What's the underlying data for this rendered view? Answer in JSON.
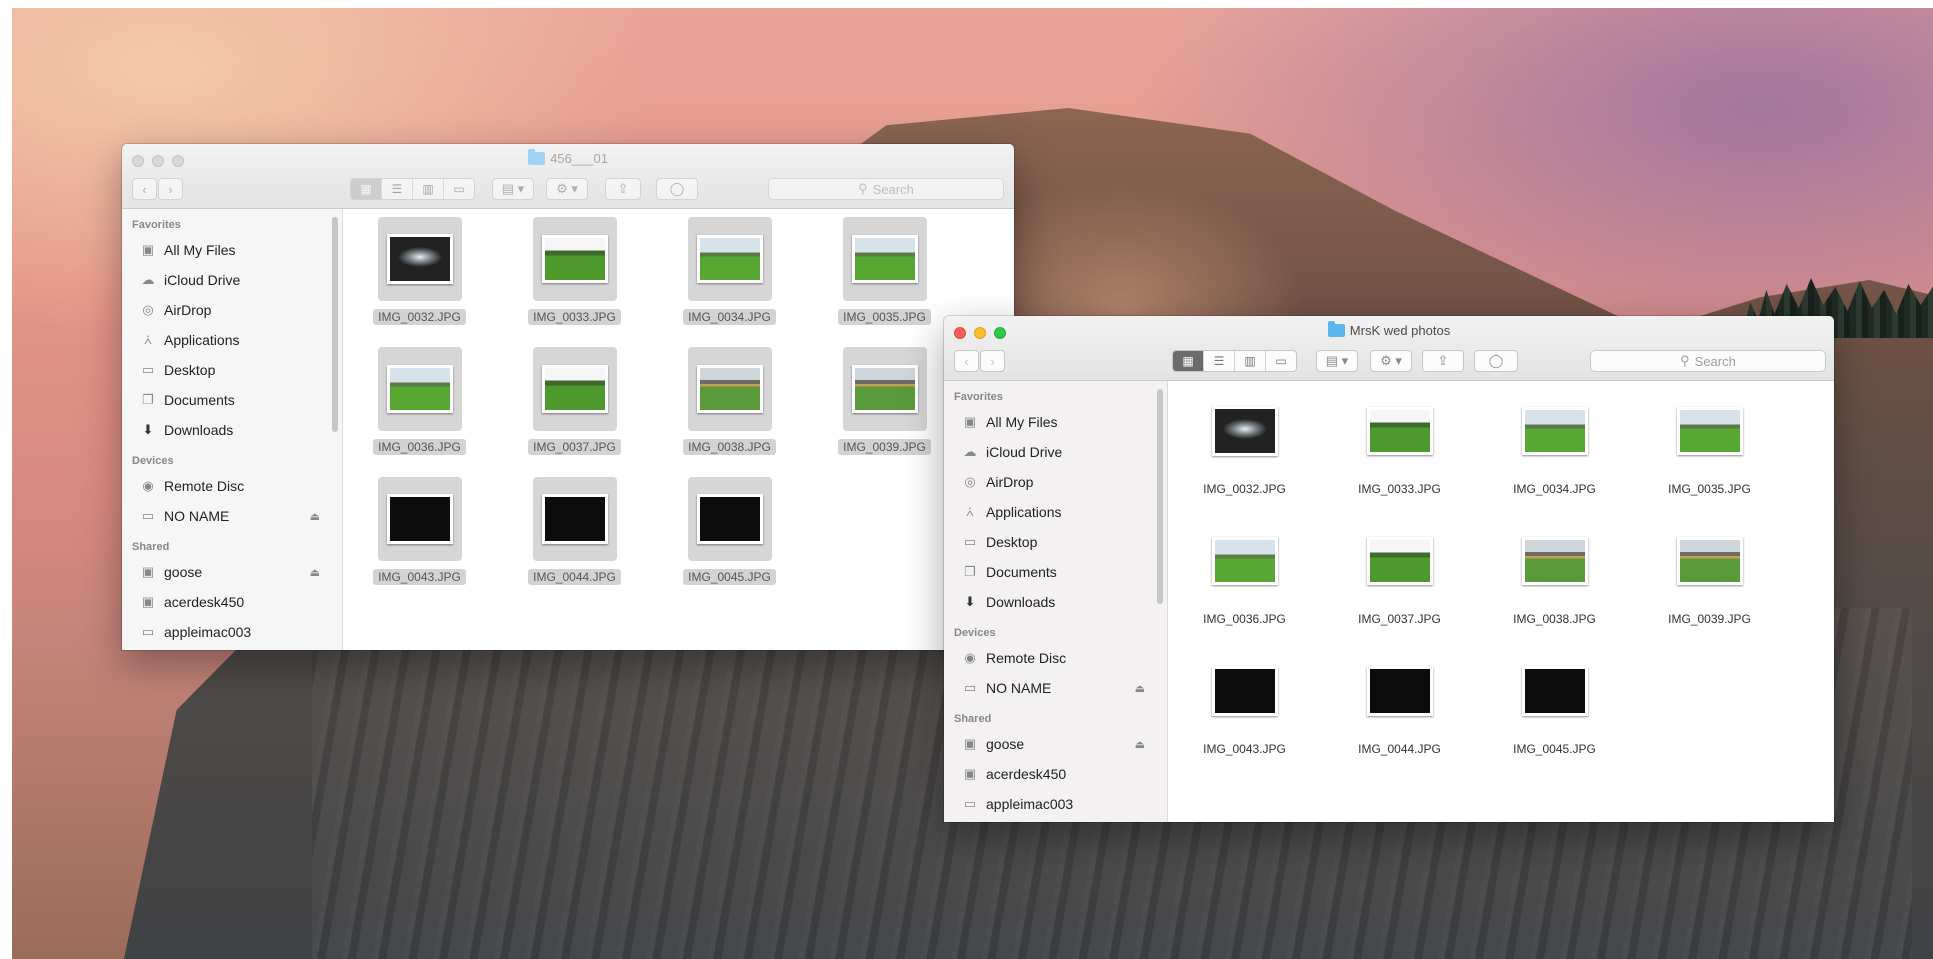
{
  "sidebar": {
    "favorites_label": "Favorites",
    "favorites": [
      "All My Files",
      "iCloud Drive",
      "AirDrop",
      "Applications",
      "Desktop",
      "Documents",
      "Downloads"
    ],
    "devices_label": "Devices",
    "devices": [
      "Remote Disc",
      "NO NAME"
    ],
    "shared_label": "Shared",
    "shared": [
      "goose",
      "acerdesk450",
      "appleimac003"
    ]
  },
  "files": [
    "IMG_0032.JPG",
    "IMG_0033.JPG",
    "IMG_0034.JPG",
    "IMG_0035.JPG",
    "IMG_0036.JPG",
    "IMG_0037.JPG",
    "IMG_0038.JPG",
    "IMG_0039.JPG",
    "IMG_0043.JPG",
    "IMG_0044.JPG",
    "IMG_0045.JPG"
  ],
  "back_window": {
    "title": "456___01",
    "search_placeholder": "Search"
  },
  "front_window": {
    "title": "MrsK wed photos",
    "search_placeholder": "Search"
  },
  "glyphs": {
    "back": "‹",
    "forward": "›",
    "search": "⚲",
    "eject": "⏏"
  }
}
